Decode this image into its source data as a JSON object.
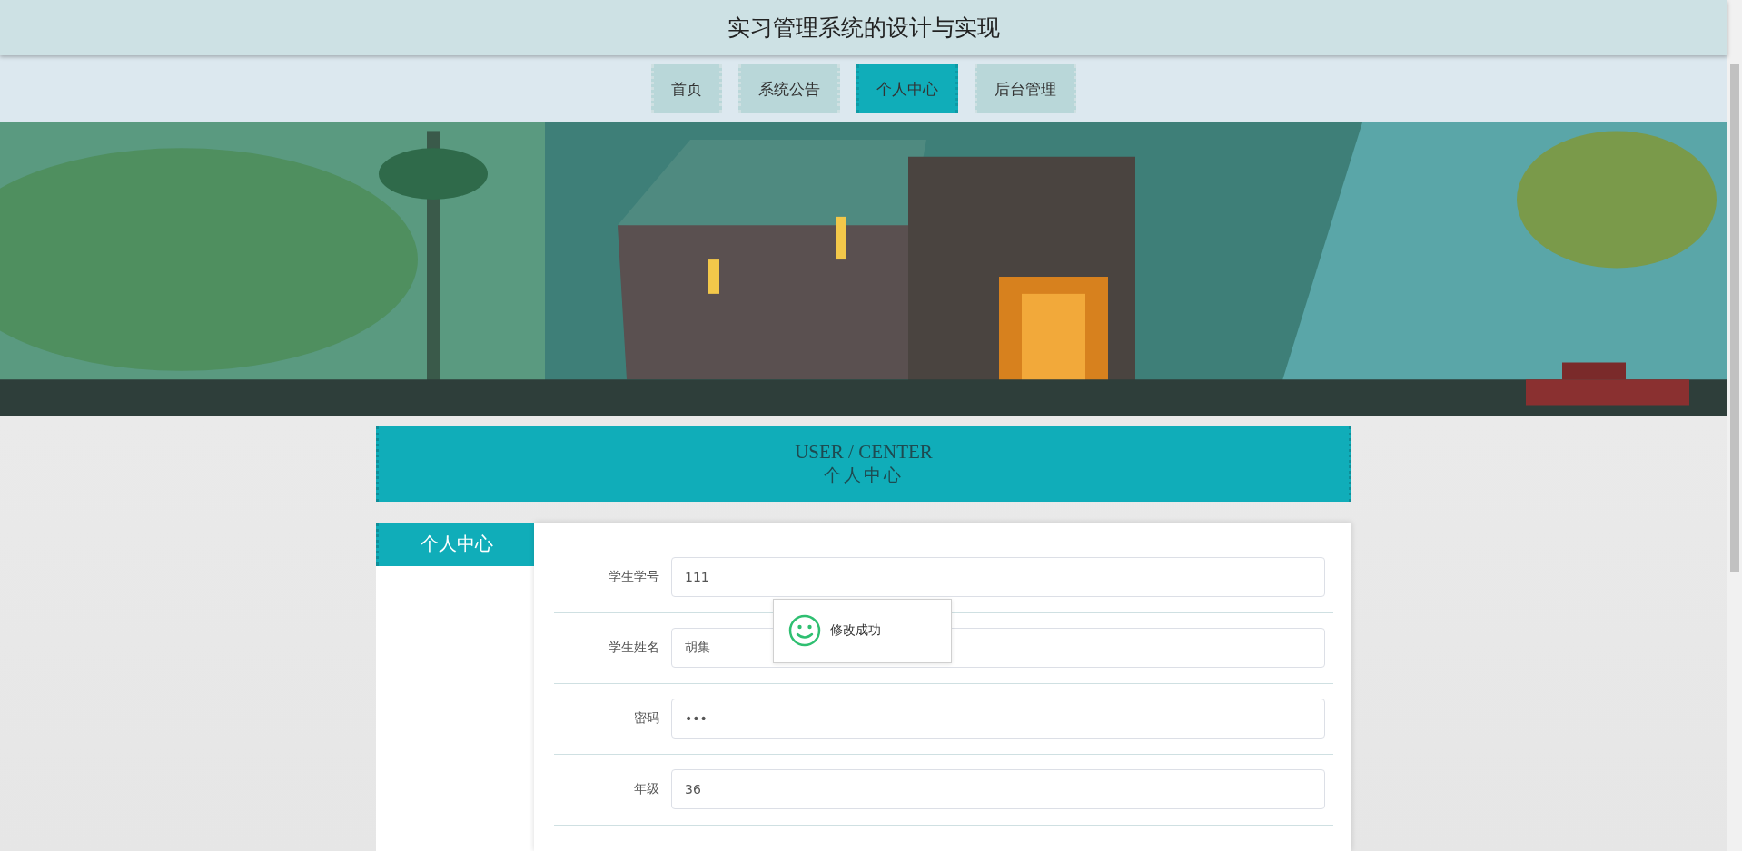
{
  "header": {
    "title": "实习管理系统的设计与实现"
  },
  "nav": [
    {
      "label": "首页",
      "selected": false
    },
    {
      "label": "系统公告",
      "selected": false
    },
    {
      "label": "个人中心",
      "selected": true
    },
    {
      "label": "后台管理",
      "selected": false
    }
  ],
  "section": {
    "title_en": "USER / CENTER",
    "title_zh": "个人中心"
  },
  "sidebar": {
    "items": [
      {
        "label": "个人中心",
        "selected": true
      }
    ]
  },
  "form": {
    "fields": [
      {
        "label": "学生学号",
        "value": "111"
      },
      {
        "label": "学生姓名",
        "value": "胡集"
      },
      {
        "label": "密码",
        "value": "•••"
      },
      {
        "label": "年级",
        "value": "36"
      }
    ]
  },
  "toast": {
    "message": "修改成功"
  }
}
